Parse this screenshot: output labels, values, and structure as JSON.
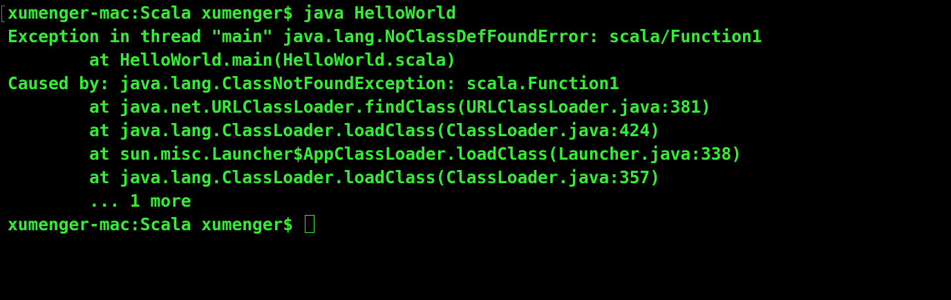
{
  "terminal": {
    "text_color": "#33ee33",
    "background_color": "#000000",
    "lines": [
      "xumenger-mac:Scala xumenger$ java HelloWorld",
      "Exception in thread \"main\" java.lang.NoClassDefFoundError: scala/Function1",
      "        at HelloWorld.main(HelloWorld.scala)",
      "Caused by: java.lang.ClassNotFoundException: scala.Function1",
      "        at java.net.URLClassLoader.findClass(URLClassLoader.java:381)",
      "        at java.lang.ClassLoader.loadClass(ClassLoader.java:424)",
      "        at sun.misc.Launcher$AppClassLoader.loadClass(Launcher.java:338)",
      "        at java.lang.ClassLoader.loadClass(ClassLoader.java:357)",
      "        ... 1 more"
    ],
    "prompt": "xumenger-mac:Scala xumenger$ "
  }
}
